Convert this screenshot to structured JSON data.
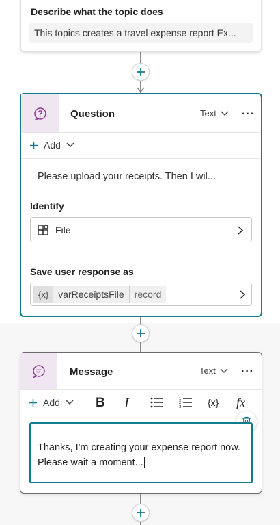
{
  "top_card": {
    "label": "Describe what the topic does",
    "description": "This topics creates a travel expense report Ex..."
  },
  "question_node": {
    "title": "Question",
    "type_label": "Text",
    "add_label": "Add",
    "prompt": "Please upload your receipts. Then I wil...",
    "identify_label": "Identify",
    "identify_value": "File",
    "save_label": "Save user response as",
    "var_icon": "{x}",
    "var_name": "varReceiptsFile",
    "var_type": "record"
  },
  "message_node": {
    "title": "Message",
    "type_label": "Text",
    "add_label": "Add",
    "bold_label": "B",
    "italic_label": "I",
    "var_label": "{x}",
    "fx_label": "fx",
    "message_text": "Thanks, I'm creating your expense report now. Please wait a moment..."
  },
  "colors": {
    "accent": "#117a8b",
    "icon_bg": "#f0e6f2",
    "node_icon": "#8a3a8f"
  }
}
